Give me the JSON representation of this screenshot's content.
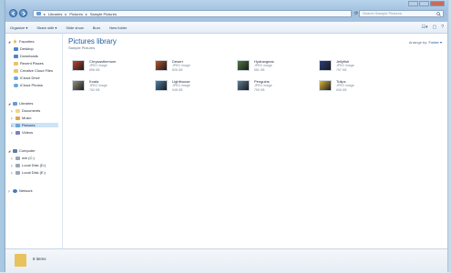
{
  "address": {
    "crumbs": [
      "Libraries",
      "Pictures",
      "Sample Pictures"
    ]
  },
  "search": {
    "placeholder": "Search Sample Pictures"
  },
  "toolbar": {
    "organize": "Organize ▾",
    "share": "Share with ▾",
    "slideshow": "Slide show",
    "burn": "Burn",
    "newfolder": "New folder"
  },
  "nav": {
    "favorites": "Favorites",
    "desktop": "Desktop",
    "downloads": "Downloads",
    "recent": "Recent Places",
    "creative": "Creative Cloud Files",
    "icloud_drive": "iCloud Drive",
    "icloud_photos": "iCloud Photos",
    "libraries": "Libraries",
    "documents": "Documents",
    "music": "Music",
    "pictures": "Pictures",
    "videos": "Videos",
    "computer": "Computer",
    "win_c": "win (C:)",
    "local_d": "Local Disk (D:)",
    "local_e": "Local Disk (E:)",
    "network": "Network"
  },
  "main": {
    "title": "Pictures library",
    "subtitle": "Sample Pictures",
    "arrange_label": "Arrange by:",
    "arrange_value": "Folder ▾"
  },
  "files": [
    {
      "name": "Chrysanthemum",
      "type": "JPEG image",
      "size": "858 KB",
      "color": "#c2452a"
    },
    {
      "name": "Desert",
      "type": "JPEG image",
      "size": "826 KB",
      "color": "#b5562c"
    },
    {
      "name": "Hydrangeas",
      "type": "JPEG image",
      "size": "581 KB",
      "color": "#4f7a3c"
    },
    {
      "name": "Jellyfish",
      "type": "JPEG image",
      "size": "757 KB",
      "color": "#2b3f7a"
    },
    {
      "name": "Koala",
      "type": "JPEG image",
      "size": "762 KB",
      "color": "#9a8f7e"
    },
    {
      "name": "Lighthouse",
      "type": "JPEG image",
      "size": "548 KB",
      "color": "#4d7fa8"
    },
    {
      "name": "Penguins",
      "type": "JPEG image",
      "size": "759 KB",
      "color": "#5d7d95"
    },
    {
      "name": "Tulips",
      "type": "JPEG image",
      "size": "606 KB",
      "color": "#d9b43a"
    }
  ],
  "status": {
    "text": "8 items"
  }
}
